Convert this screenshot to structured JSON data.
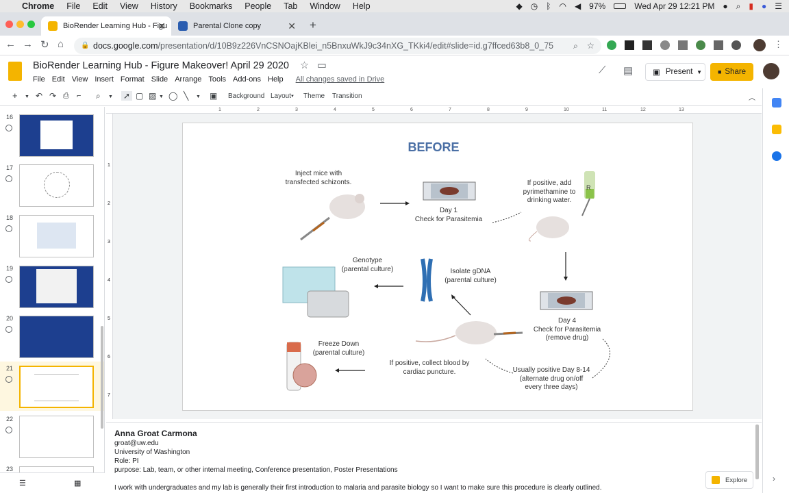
{
  "menubar": {
    "app": "Chrome",
    "items": [
      "File",
      "Edit",
      "View",
      "History",
      "Bookmarks",
      "People",
      "Tab",
      "Window",
      "Help"
    ],
    "battery": "97%",
    "clock": "Wed Apr 29  12:21 PM"
  },
  "tabs": [
    {
      "title": "BioRender Learning Hub - Figu",
      "favicon": "slides-icon"
    },
    {
      "title": "Parental Clone copy",
      "favicon": "biorender-icon"
    }
  ],
  "address": {
    "domain": "docs.google.com",
    "path": "/presentation/d/10B9z226VnCSNOajKBlei_n5BnxuWkJ9c34nXG_TKki4/edit#slide=id.g7ffced63b8_0_75"
  },
  "doc": {
    "title": "BioRender Learning Hub - Figure Makeover! April 29 2020",
    "menu": [
      "File",
      "Edit",
      "View",
      "Insert",
      "Format",
      "Slide",
      "Arrange",
      "Tools",
      "Add-ons",
      "Help"
    ],
    "saved_status": "All changes saved in Drive",
    "present_label": "Present",
    "share_label": "Share"
  },
  "toolbar": {
    "background": "Background",
    "layout": "Layout",
    "theme": "Theme",
    "transition": "Transition"
  },
  "ruler_ticks": [
    "1",
    "2",
    "3",
    "4",
    "5",
    "6",
    "7",
    "8",
    "9",
    "10",
    "11",
    "12",
    "13"
  ],
  "vruler_ticks": [
    "1",
    "2",
    "3",
    "4",
    "5",
    "6",
    "7"
  ],
  "slides": [
    {
      "num": "16"
    },
    {
      "num": "17"
    },
    {
      "num": "18"
    },
    {
      "num": "19"
    },
    {
      "num": "20"
    },
    {
      "num": "21"
    },
    {
      "num": "22"
    },
    {
      "num": "23"
    }
  ],
  "slide": {
    "heading": "BEFORE",
    "inject": "Inject mice with\ntransfected schizonts.",
    "day1": "Day 1\nCheck for Parasitemia",
    "ifpositive": "If positive, add\npyrimethamine to\ndrinking water.",
    "genotype": "Genotype\n(parental culture)",
    "isolate": "Isolate gDNA\n(parental culture)",
    "day4": "Day 4\nCheck for Parasitemia\n(remove drug)",
    "freeze": "Freeze Down\n(parental culture)",
    "collect": "If positive, collect blood by\ncardiac puncture.",
    "usually": "Usually positive Day 8-14\n(alternate drug on/off\nevery three days)",
    "rx": "R"
  },
  "notes": {
    "name": "Anna Groat Carmona",
    "email": "groat@uw.edu",
    "org": "University of Washington",
    "role": "Role: PI",
    "purpose": "purpose: Lab, team, or other internal meeting, Conference presentation, Poster Presentations",
    "body": "I work with undergraduates and my lab is generally their first introduction to malaria and parasite biology so I want to make sure this procedure is clearly outlined."
  },
  "explore_label": "Explore",
  "colors": {
    "accent": "#f4b400",
    "slide_blue": "#1d3f8f",
    "before_blue": "#4a6fa5"
  }
}
